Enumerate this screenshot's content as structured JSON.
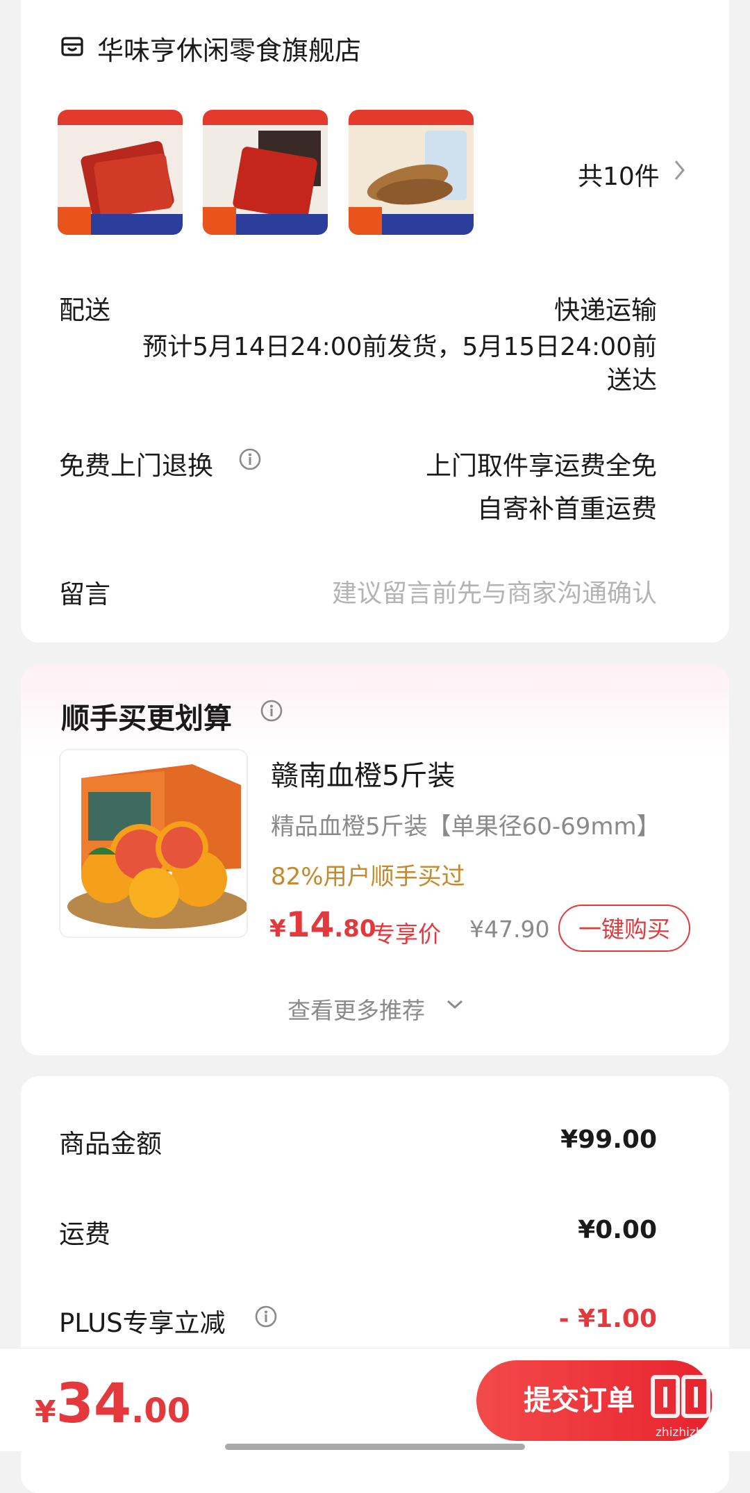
{
  "store": {
    "name": "华味亨休闲零食旗舰店"
  },
  "items": {
    "count_label": "共10件"
  },
  "delivery": {
    "label": "配送",
    "method": "快递运输",
    "estimate_line1": "预计5月14日24:00前发货，5月15日24:00前",
    "estimate_line2": "送达"
  },
  "returns": {
    "label": "免费上门退换",
    "line1": "上门取件享运费全免",
    "line2": "自寄补首重运费"
  },
  "message": {
    "label": "留言",
    "placeholder": "建议留言前先与商家沟通确认"
  },
  "recommend": {
    "title": "顺手买更划算",
    "product": {
      "name": "赣南血橙5斤装",
      "spec": "精品血橙5斤装【单果径60-69mm】",
      "hint": "82%用户顺手买过",
      "price_symbol": "¥",
      "price_int": "14",
      "price_dec": ".80",
      "price_tag": "专享价",
      "original_price": "¥47.90",
      "buy_label": "一键购买"
    },
    "more_label": "查看更多推荐"
  },
  "summary": {
    "goods_label": "商品金额",
    "goods_value": "¥99.00",
    "shipping_label": "运费",
    "shipping_value": "¥0.00",
    "plus_label": "PLUS专享立减",
    "plus_value": "- ¥1.00"
  },
  "footer": {
    "total_symbol": "¥",
    "total_int": "34",
    "total_dec": ".00",
    "submit_label": "提交订单"
  },
  "colors": {
    "accent": "#e4393c",
    "hint": "#c4892c",
    "muted": "#8a8a8a"
  }
}
